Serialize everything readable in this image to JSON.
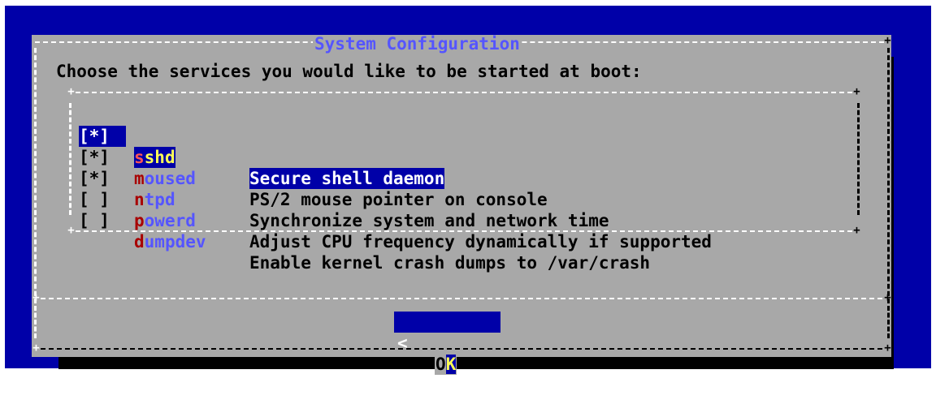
{
  "dialog": {
    "title": "System Configuration",
    "prompt": "Choose the services you would like to be started at boot:"
  },
  "services": [
    {
      "check": "[*]",
      "hotkey": "s",
      "rest": "shd",
      "description": "Secure shell daemon",
      "checked": true,
      "selected": true
    },
    {
      "check": "[*]",
      "hotkey": "m",
      "rest": "oused",
      "description": "PS/2 mouse pointer on console",
      "checked": true,
      "selected": false
    },
    {
      "check": "[*]",
      "hotkey": "n",
      "rest": "tpd",
      "description": "Synchronize system and network time",
      "checked": true,
      "selected": false
    },
    {
      "check": "[ ]",
      "hotkey": "p",
      "rest": "owerd",
      "description": "Adjust CPU frequency dynamically if supported",
      "checked": false,
      "selected": false
    },
    {
      "check": "[ ]",
      "hotkey": "d",
      "rest": "umpdev",
      "description": "Enable kernel crash dumps to /var/crash",
      "checked": false,
      "selected": false
    }
  ],
  "buttons": {
    "ok": {
      "left": "<",
      "prefix": "O",
      "hotkey": "K",
      "right": ">"
    }
  },
  "colors": {
    "background": "#0000a8",
    "dialog": "#a8a8a8",
    "title": "#5555ff",
    "hotkey": "#a80000",
    "selected_fg": "#ffff55"
  }
}
